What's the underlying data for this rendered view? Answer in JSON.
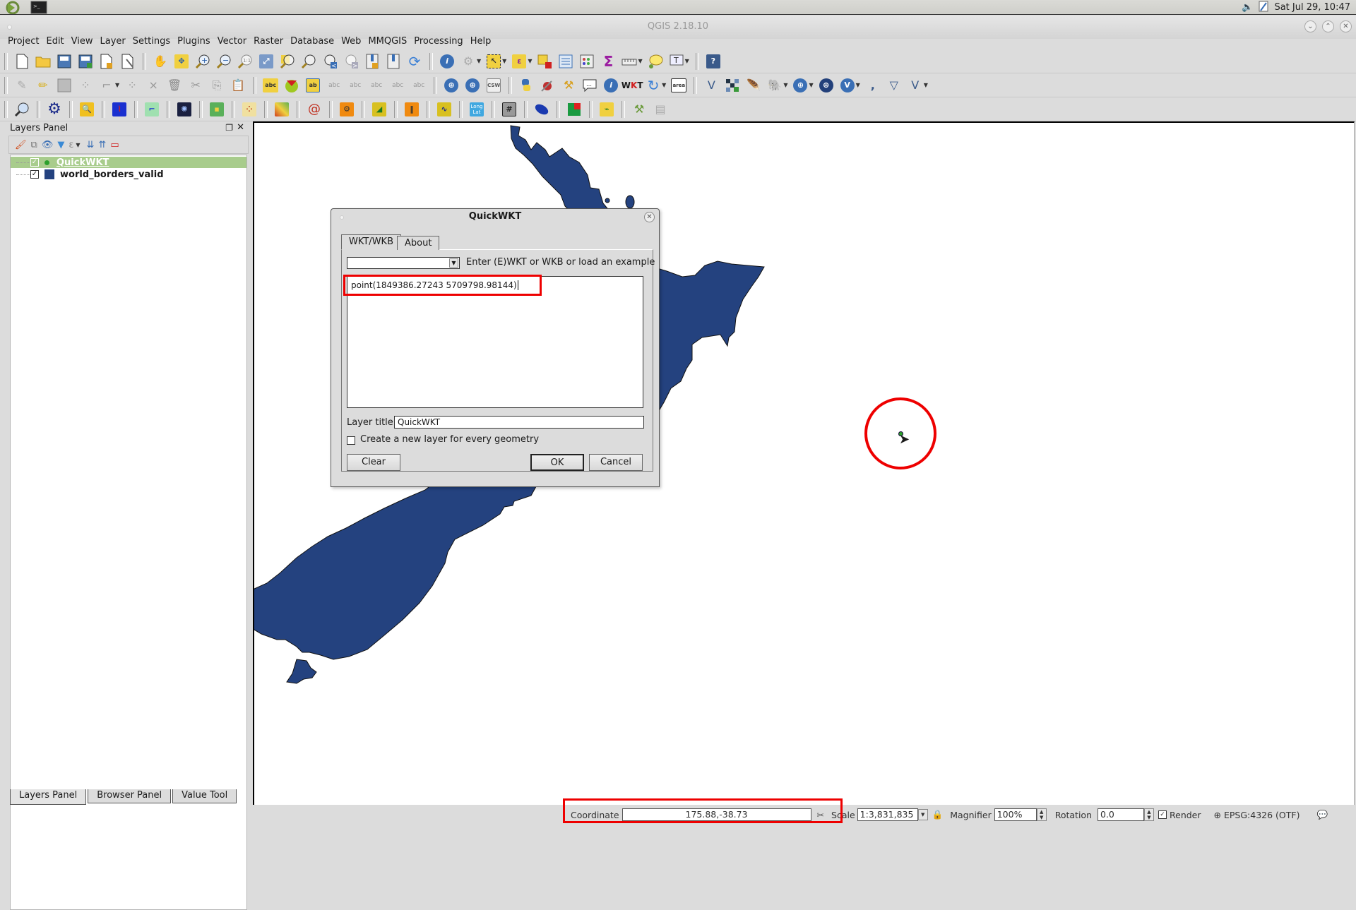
{
  "taskbar": {
    "apps": [
      "qgis-launcher-icon",
      "terminal-icon"
    ],
    "clock": "Sat Jul 29, 10:47"
  },
  "window": {
    "title": "QGIS 2.18.10",
    "buttons": [
      "minimize",
      "maximize",
      "close"
    ]
  },
  "menubar": [
    "Project",
    "Edit",
    "View",
    "Layer",
    "Settings",
    "Plugins",
    "Vector",
    "Raster",
    "Database",
    "Web",
    "MMQGIS",
    "Processing",
    "Help"
  ],
  "toolbars": {
    "row1": [
      "new-project",
      "open-project",
      "save-project",
      "save-as",
      "new-print-composer",
      "composer-manager",
      "pan",
      "pan-to-selection",
      "zoom-in",
      "zoom-out",
      "zoom-native",
      "zoom-full",
      "zoom-to-selection",
      "zoom-to-layer",
      "zoom-last",
      "zoom-next",
      "new-bookmark",
      "show-bookmarks",
      "refresh",
      "identify",
      "run-action",
      "select-features",
      "select-by-expression",
      "deselect",
      "attribute-table",
      "field-calculator",
      "statistics",
      "measure",
      "map-tips",
      "text-annotation",
      "help"
    ],
    "row2": [
      "current-edits",
      "toggle-editing",
      "save-edits",
      "add-feature",
      "move-feature",
      "node-tool",
      "delete-selected",
      "cut",
      "copy",
      "paste",
      "labeling",
      "layer-diagram",
      "pin-labels",
      "show-hide-labels",
      "move-label",
      "rotate-label",
      "change-label",
      "add-wms",
      "add-wcs",
      "csw",
      "python-console",
      "plugin-a",
      "plugin-b",
      "quickwkt-speech",
      "identify-plus",
      "wkt",
      "refresh-plugin",
      "area",
      "add-vector",
      "add-raster",
      "add-spatialite",
      "add-postgis",
      "add-wms-layer",
      "add-wfs",
      "add-wcs-layer",
      "add-delimited",
      "new-shapefile",
      "new-temp-layer"
    ],
    "row3": [
      "geo-search",
      "gear-plugin",
      "zoom-search",
      "rivers",
      "profile",
      "warp",
      "grid",
      "heatmap",
      "raster-calc",
      "spiral",
      "gears",
      "dish",
      "audio",
      "sine",
      "long-lat",
      "mesh",
      "mouse",
      "flag",
      "plug",
      "tools",
      "scroll"
    ],
    "long_lat_label": [
      "Long",
      "Lat"
    ],
    "csw_label": "CSW",
    "area_label": "area",
    "abc_label": "abc"
  },
  "layers_panel": {
    "title": "Layers Panel",
    "layers": [
      {
        "name": "QuickWKT",
        "checked": true,
        "selected": true,
        "symbol_color": "#2ca02c"
      },
      {
        "name": "world_borders_valid",
        "checked": true,
        "selected": false,
        "symbol_color": "#24427f"
      }
    ],
    "bottom_tabs": [
      "Layers Panel",
      "Browser Panel",
      "Value Tool"
    ]
  },
  "dialog": {
    "title": "QuickWKT",
    "tabs": [
      "WKT/WKB",
      "About"
    ],
    "active_tab": "WKT/WKB",
    "example_select_value": "",
    "hint": "Enter (E)WKT or WKB or load an example",
    "wkt_text": "point(1849386.27243 5709798.98144)",
    "layer_title_label": "Layer title",
    "layer_title_value": "QuickWKT",
    "new_layer_checkbox_label": "Create a new layer for every geometry",
    "new_layer_checked": false,
    "buttons": {
      "clear": "Clear",
      "ok": "OK",
      "cancel": "Cancel"
    }
  },
  "map": {
    "land_color": "#24427f",
    "highlight_color": "#e00000"
  },
  "statusbar": {
    "coordinate_label": "Coordinate",
    "coordinate_value": "175.88,-38.73",
    "scale_label": "Scale",
    "scale_value": "1:3,831,835",
    "magnifier_label": "Magnifier",
    "magnifier_value": "100%",
    "rotation_label": "Rotation",
    "rotation_value": "0.0",
    "render_label": "Render",
    "render_checked": true,
    "crs": "EPSG:4326 (OTF)"
  }
}
